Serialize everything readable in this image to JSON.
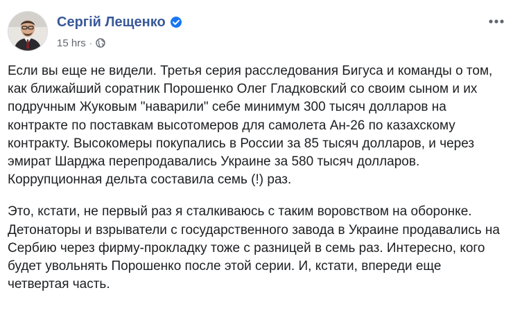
{
  "author": {
    "name": "Сергій Лещенко",
    "verified_icon": "verified-badge-icon"
  },
  "meta": {
    "timestamp": "15 hrs",
    "separator": "·",
    "audience_icon": "globe-icon"
  },
  "post": {
    "paragraphs": [
      "Если вы еще не видели. Третья серия расследования Бигуса и команды о том, как ближайший соратник Порошенко Олег Гладковский со своим сыном и их подручным Жуковым \"наварили\" себе минимум 300 тысяч долларов на контракте по поставкам высотомеров для самолета Ан-26 по казахскому контракту. Высокомеры покупались в России за 85 тысяч долларов, и через эмират Шарджа перепродавались Украине за 580 тысяч долларов. Коррупционная дельта составила семь (!) раз.",
      "Это, кстати, не первый раз я сталкиваюсь с таким воровством на оборонке. Детонаторы и взрыватели с государственного завода в Украине продавались на Сербию через фирму-прокладку тоже с разницей в семь раз. Интересно, кого будет увольнять Порошенко после этой серии. И, кстати, впереди еще четвертая часть."
    ]
  },
  "colors": {
    "author_link": "#385898",
    "verified": "#1877f2",
    "meta_text": "#616770",
    "body_text": "#1c1e21"
  }
}
